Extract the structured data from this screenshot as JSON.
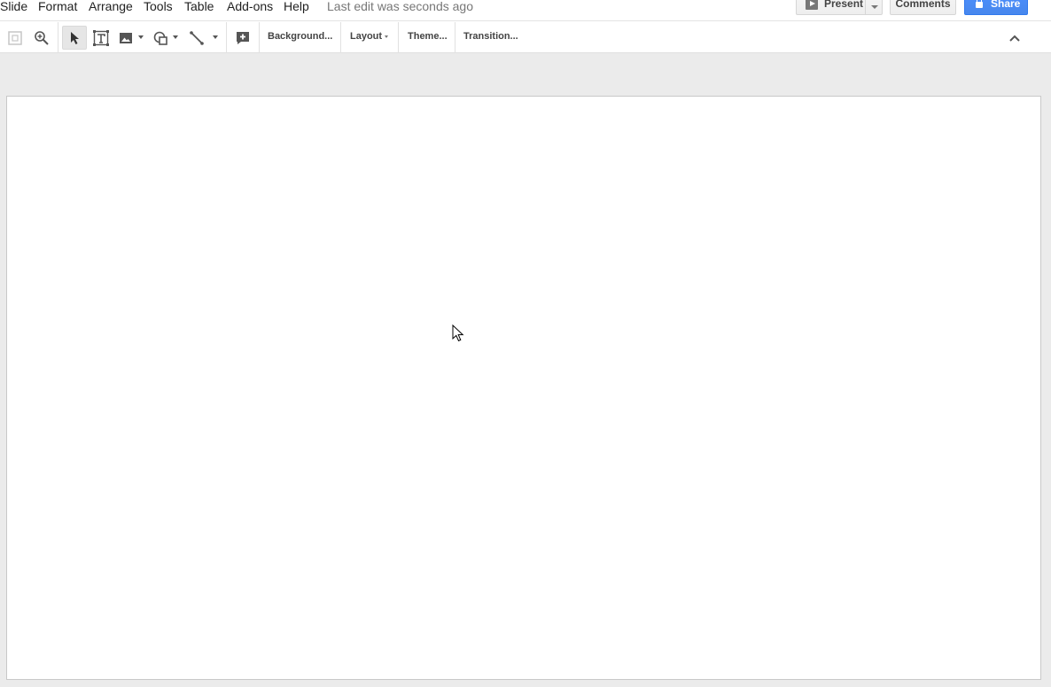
{
  "menubar": {
    "items": [
      {
        "label": "Slide"
      },
      {
        "label": "Format"
      },
      {
        "label": "Arrange"
      },
      {
        "label": "Tools"
      },
      {
        "label": "Table"
      },
      {
        "label": "Add-ons"
      },
      {
        "label": "Help"
      }
    ],
    "last_edit": "Last edit was seconds ago"
  },
  "header_buttons": {
    "present_label": "Present",
    "comments_label": "Comments",
    "share_label": "Share",
    "share_color": "#4d90fe"
  },
  "toolbar": {
    "icons": [
      "fit-zoom-icon",
      "zoom-icon",
      "select-pointer-icon",
      "text-box-icon",
      "image-icon",
      "shape-icon",
      "line-icon",
      "new-comment-icon",
      "collapse-chevron-icon"
    ],
    "background_label": "Background...",
    "layout_label": "Layout",
    "theme_label": "Theme...",
    "transition_label": "Transition..."
  }
}
